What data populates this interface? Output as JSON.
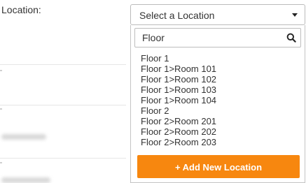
{
  "form": {
    "location_label": "Location:"
  },
  "location_select": {
    "selected_text": "Select a Location",
    "search": {
      "value": "Floor",
      "placeholder": ""
    },
    "options": [
      "Floor 1",
      "Floor 1>Room 101",
      "Floor 1>Room 102",
      "Floor 1>Room 103",
      "Floor 1>Room 104",
      "Floor 2",
      "Floor 2>Room 201",
      "Floor 2>Room 202",
      "Floor 2>Room 203"
    ],
    "add_button_label": "+ Add New Location",
    "search_icon": "search-icon",
    "caret_icon": "caret-down-icon"
  },
  "colors": {
    "accent": "#f7870f",
    "text": "#333333",
    "border": "#bbbbbb"
  }
}
